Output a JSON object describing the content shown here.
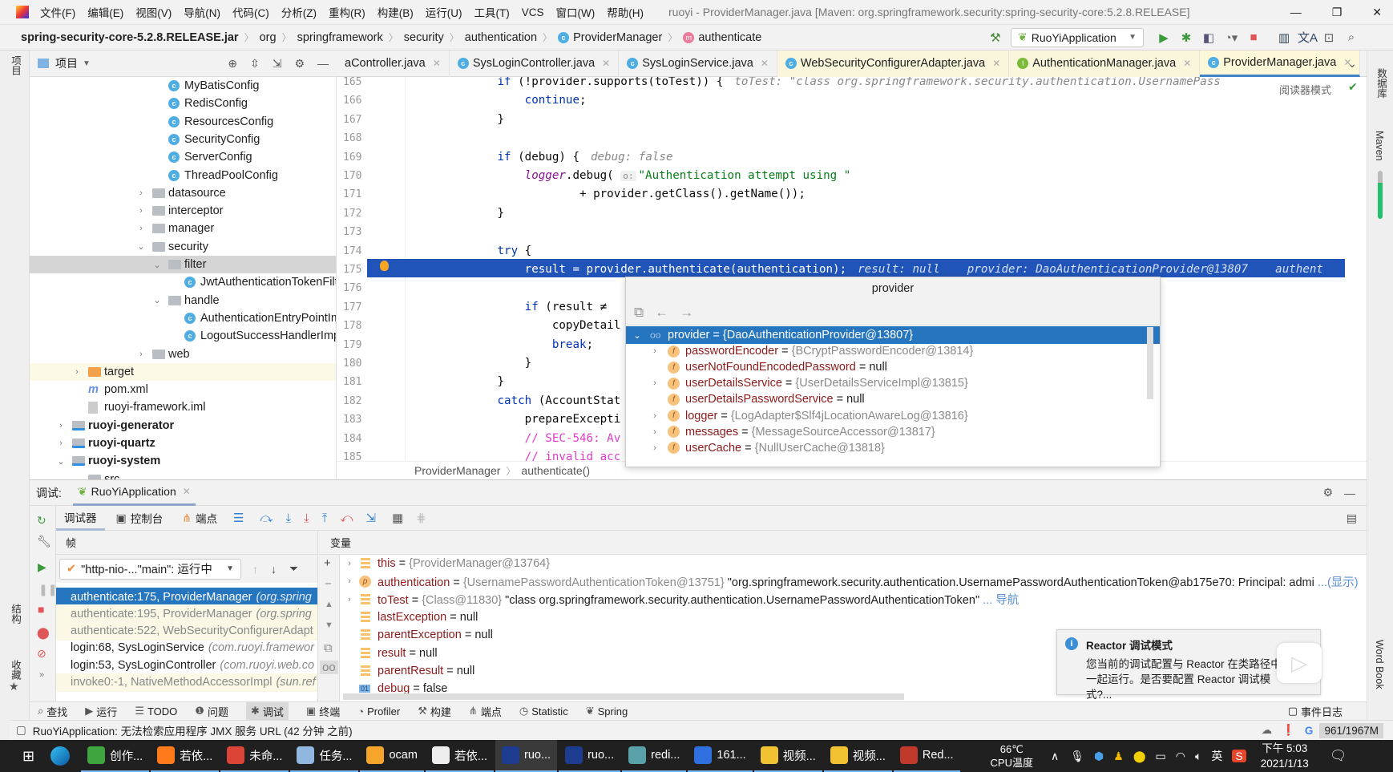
{
  "menu": {
    "items": [
      "文件(F)",
      "编辑(E)",
      "视图(V)",
      "导航(N)",
      "代码(C)",
      "分析(Z)",
      "重构(R)",
      "构建(B)",
      "运行(U)",
      "工具(T)",
      "VCS",
      "窗口(W)",
      "帮助(H)"
    ],
    "title": "ruoyi - ProviderManager.java [Maven: org.springframework.security:spring-security-core:5.2.8.RELEASE]"
  },
  "nav": {
    "crumbs": [
      "spring-security-core-5.2.8.RELEASE.jar",
      "org",
      "springframework",
      "security",
      "authentication"
    ],
    "class_crumb": "ProviderManager",
    "method_crumb": "authenticate",
    "run_config": "RuoYiApplication"
  },
  "project": {
    "label": "项目",
    "items": [
      {
        "label": "MyBatisConfig",
        "depth": 6,
        "kind": "class"
      },
      {
        "label": "RedisConfig",
        "depth": 6,
        "kind": "class"
      },
      {
        "label": "ResourcesConfig",
        "depth": 6,
        "kind": "class"
      },
      {
        "label": "SecurityConfig",
        "depth": 6,
        "kind": "class"
      },
      {
        "label": "ServerConfig",
        "depth": 6,
        "kind": "class"
      },
      {
        "label": "ThreadPoolConfig",
        "depth": 6,
        "kind": "class"
      },
      {
        "label": "datasource",
        "depth": 5,
        "kind": "folder",
        "expand": "collapsed"
      },
      {
        "label": "interceptor",
        "depth": 5,
        "kind": "folder",
        "expand": "collapsed"
      },
      {
        "label": "manager",
        "depth": 5,
        "kind": "folder",
        "expand": "collapsed"
      },
      {
        "label": "security",
        "depth": 5,
        "kind": "folder",
        "expand": "expanded"
      },
      {
        "label": "filter",
        "depth": 6,
        "kind": "folder",
        "expand": "expanded",
        "selected": true
      },
      {
        "label": "JwtAuthenticationTokenFilt",
        "depth": 7,
        "kind": "class"
      },
      {
        "label": "handle",
        "depth": 6,
        "kind": "folder",
        "expand": "expanded"
      },
      {
        "label": "AuthenticationEntryPointIm",
        "depth": 7,
        "kind": "class"
      },
      {
        "label": "LogoutSuccessHandlerImp",
        "depth": 7,
        "kind": "class"
      },
      {
        "label": "web",
        "depth": 5,
        "kind": "folder",
        "expand": "collapsed"
      },
      {
        "label": "target",
        "depth": 1,
        "kind": "target",
        "expand": "collapsed",
        "highlight": true
      },
      {
        "label": "pom.xml",
        "depth": 1,
        "kind": "maven"
      },
      {
        "label": "ruoyi-framework.iml",
        "depth": 1,
        "kind": "iml"
      },
      {
        "label": "ruoyi-generator",
        "depth": 0,
        "kind": "module",
        "expand": "collapsed"
      },
      {
        "label": "ruoyi-quartz",
        "depth": 0,
        "kind": "module",
        "expand": "collapsed"
      },
      {
        "label": "ruoyi-system",
        "depth": 0,
        "kind": "module",
        "expand": "expanded"
      },
      {
        "label": "src",
        "depth": 1,
        "kind": "folder",
        "expand": "expanded"
      }
    ]
  },
  "tabs": [
    {
      "label": "aController.java",
      "kind": "class"
    },
    {
      "label": "SysLoginController.java",
      "kind": "class"
    },
    {
      "label": "SysLoginService.java",
      "kind": "class"
    },
    {
      "label": "WebSecurityConfigurerAdapter.java",
      "kind": "class",
      "lib": true
    },
    {
      "label": "AuthenticationManager.java",
      "kind": "interface",
      "lib": true
    },
    {
      "label": "ProviderManager.java",
      "kind": "class",
      "active": true
    }
  ],
  "editor": {
    "reader_mode": "阅读器模式",
    "current_line": 175,
    "lines": [
      {
        "num": "165",
        "segs": [
          [
            "            ",
            ""
          ],
          [
            "if",
            "kw"
          ],
          [
            " (!provider.supports(toTest)) {",
            ""
          ]
        ],
        "hint": "toTest: \"class org.springframework.security.authentication.UsernamePass"
      },
      {
        "num": "166",
        "segs": [
          [
            "                ",
            ""
          ],
          [
            "continue",
            "kw"
          ],
          [
            ";",
            ""
          ]
        ]
      },
      {
        "num": "167",
        "segs": [
          [
            "            }",
            ""
          ]
        ]
      },
      {
        "num": "168",
        "segs": []
      },
      {
        "num": "169",
        "segs": [
          [
            "            ",
            ""
          ],
          [
            "if",
            "kw"
          ],
          [
            " (debug) {",
            ""
          ]
        ],
        "hint": "debug: false"
      },
      {
        "num": "170",
        "segs": [
          [
            "                ",
            ""
          ],
          [
            "logger",
            "purp"
          ],
          [
            ".debug( ",
            ""
          ],
          [
            "o:",
            "phint"
          ],
          [
            "\"Authentication attempt using \"",
            "str"
          ]
        ]
      },
      {
        "num": "171",
        "segs": [
          [
            "                        + provider.getClass().getName());",
            ""
          ]
        ]
      },
      {
        "num": "172",
        "segs": [
          [
            "            }",
            ""
          ]
        ]
      },
      {
        "num": "173",
        "segs": []
      },
      {
        "num": "174",
        "segs": [
          [
            "            ",
            ""
          ],
          [
            "try",
            "kw"
          ],
          [
            " {",
            ""
          ]
        ]
      },
      {
        "num": "175",
        "segs": [
          [
            "                result = provider.authenticate(authentication);",
            ""
          ]
        ],
        "hint": "result: null    provider: DaoAuthenticationProvider@13807    authent"
      },
      {
        "num": "176",
        "segs": []
      },
      {
        "num": "177",
        "segs": [
          [
            "                ",
            ""
          ],
          [
            "if",
            "kw"
          ],
          [
            " (result ≠",
            ""
          ]
        ]
      },
      {
        "num": "178",
        "segs": [
          [
            "                    copyDetail",
            ""
          ]
        ]
      },
      {
        "num": "179",
        "segs": [
          [
            "                    ",
            ""
          ],
          [
            "break",
            "kw"
          ],
          [
            ";",
            ""
          ]
        ]
      },
      {
        "num": "180",
        "segs": [
          [
            "                }",
            ""
          ]
        ]
      },
      {
        "num": "181",
        "segs": [
          [
            "            }",
            ""
          ]
        ]
      },
      {
        "num": "182",
        "segs": [
          [
            "            ",
            ""
          ],
          [
            "catch",
            "kw"
          ],
          [
            " (AccountStat",
            ""
          ]
        ]
      },
      {
        "num": "183",
        "segs": [
          [
            "                prepareExcepti",
            ""
          ]
        ]
      },
      {
        "num": "184",
        "segs": [
          [
            "                ",
            ""
          ],
          [
            "// SEC-546: Av",
            "cm"
          ]
        ]
      },
      {
        "num": "185",
        "segs": [
          [
            "                ",
            ""
          ],
          [
            "// invalid acc",
            "cm"
          ]
        ]
      }
    ],
    "breadcrumb": [
      "ProviderManager",
      "authenticate()"
    ]
  },
  "popup": {
    "title": "provider",
    "rows": [
      {
        "name": "provider",
        "value": "{DaoAuthenticationProvider@13807}",
        "expand": "expanded",
        "icon": "watch",
        "selected": true,
        "depth": 0
      },
      {
        "name": "passwordEncoder",
        "value": "{BCryptPasswordEncoder@13814}",
        "expand": "collapsed",
        "icon": "field",
        "depth": 1
      },
      {
        "name": "userNotFoundEncodedPassword",
        "value": "null",
        "icon": "field",
        "depth": 1
      },
      {
        "name": "userDetailsService",
        "value": "{UserDetailsServiceImpl@13815}",
        "expand": "collapsed",
        "icon": "field",
        "depth": 1
      },
      {
        "name": "userDetailsPasswordService",
        "value": "null",
        "icon": "field",
        "depth": 1
      },
      {
        "name": "logger",
        "value": "{LogAdapter$Slf4jLocationAwareLog@13816}",
        "expand": "collapsed",
        "icon": "field",
        "depth": 1
      },
      {
        "name": "messages",
        "value": "{MessageSourceAccessor@13817}",
        "expand": "collapsed",
        "icon": "field",
        "depth": 1
      },
      {
        "name": "userCache",
        "value": "{NullUserCache@13818}",
        "expand": "collapsed",
        "icon": "field",
        "depth": 1
      }
    ]
  },
  "right_strip": [
    "数据库",
    "Maven",
    "Word Book"
  ],
  "left_strip": [
    "项目",
    "结构",
    "收藏"
  ],
  "debug": {
    "label": "调试:",
    "session": "RuoYiApplication",
    "tabs": [
      "调试器",
      "控制台",
      "端点"
    ],
    "frames_label": "帧",
    "vars_label": "变量",
    "thread": "\"http-nio-...\"main\": 运行中",
    "frames": [
      {
        "method": "authenticate:175, ProviderManager",
        "pkg": "(org.spring",
        "selected": true,
        "lib": true
      },
      {
        "method": "authenticate:195, ProviderManager",
        "pkg": "(org.spring",
        "lib": true
      },
      {
        "method": "authenticate:522, WebSecurityConfigurerAdapt",
        "pkg": "",
        "lib": true
      },
      {
        "method": "login:68, SysLoginService",
        "pkg": "(com.ruoyi.framewor"
      },
      {
        "method": "login:53, SysLoginController",
        "pkg": "(com.ruoyi.web.co"
      },
      {
        "method": "invoke0:-1, NativeMethodAccessorImpl",
        "pkg": "(sun.ref",
        "lib": true
      }
    ],
    "vars": [
      {
        "name": "this",
        "ref": "{ProviderManager@13764}",
        "expand": true,
        "icon": "local"
      },
      {
        "name": "authentication",
        "ref": "{UsernamePasswordAuthenticationToken@13751}",
        "str": "\"org.springframework.security.authentication.UsernamePasswordAuthenticationToken@ab175e70: Principal: admi",
        "link": "...(显示)",
        "expand": true,
        "icon": "param"
      },
      {
        "name": "toTest",
        "ref": "{Class@11830}",
        "str": "\"class org.springframework.security.authentication.UsernamePasswordAuthenticationToken\"",
        "link": "... 导航",
        "expand": true,
        "icon": "local"
      },
      {
        "name": "lastException",
        "val": "null",
        "icon": "local"
      },
      {
        "name": "parentException",
        "val": "null",
        "icon": "local"
      },
      {
        "name": "result",
        "val": "null",
        "icon": "local"
      },
      {
        "name": "parentResult",
        "val": "null",
        "icon": "local"
      },
      {
        "name": "debug",
        "val": "false",
        "icon": "bool"
      }
    ],
    "notification": {
      "title": "Reactor 调试模式",
      "body": "您当前的调试配置与 Reactor 在类路径中一起运行。是否要配置 Reactor 调试模式?..."
    }
  },
  "bottombar": {
    "items": [
      "查找",
      "运行",
      "TODO",
      "问题",
      "调试",
      "终端",
      "Profiler",
      "构建",
      "端点",
      "Statistic",
      "Spring"
    ],
    "active": "调试",
    "event_log": "事件日志"
  },
  "status": {
    "message": "RuoYiApplication: 无法检索应用程序 JMX 服务 URL (42 分钟 之前)",
    "memory": "961/1967M"
  },
  "taskbar": {
    "apps": [
      {
        "label": "创作...",
        "color": "#3fa63f"
      },
      {
        "label": "若依...",
        "color": "#ff7a1a"
      },
      {
        "label": "未命...",
        "color": "#db4437"
      },
      {
        "label": "任务...",
        "color": "#8fb7e0"
      },
      {
        "label": "ocam",
        "color": "#f4a52a"
      },
      {
        "label": "若依...",
        "color": "#eeeeee"
      },
      {
        "label": "ruo...",
        "color": "#1d3b8f",
        "active": true
      },
      {
        "label": "ruo...",
        "color": "#1d3b8f"
      },
      {
        "label": "redi...",
        "color": "#5aa0a8"
      },
      {
        "label": "161...",
        "color": "#2f6fe0"
      },
      {
        "label": "视频...",
        "color": "#f1c232"
      },
      {
        "label": "视频...",
        "color": "#f1c232"
      },
      {
        "label": "Red...",
        "color": "#c0392b"
      }
    ],
    "cpu_temp": "66℃",
    "cpu_label": "CPU温度",
    "ime": "英",
    "time": "下午 5:03",
    "date": "2021/1/13"
  }
}
